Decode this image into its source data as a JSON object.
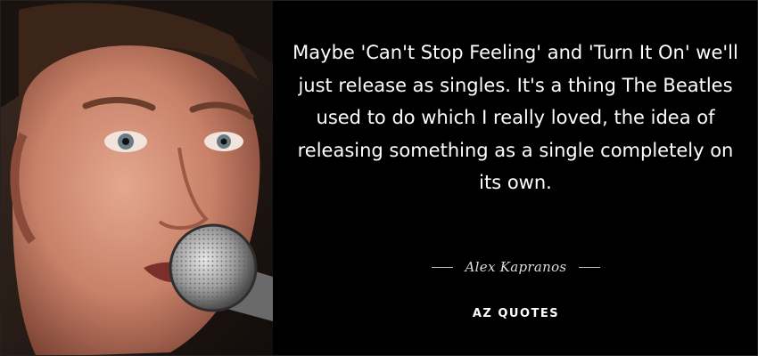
{
  "quote": {
    "text": "Maybe 'Can't Stop Feeling' and 'Turn It On' we'll just release as singles. It's a thing The Beatles used to do which I really loved, the idea of releasing something as a single completely on its own.",
    "author": "Alex Kapranos"
  },
  "brand": {
    "logo_text": "AZ QUOTES"
  },
  "photo": {
    "subject": "portrait of man singing into microphone"
  },
  "colors": {
    "background": "#000000",
    "text": "#ffffff",
    "accent": "#bbbbbb"
  }
}
